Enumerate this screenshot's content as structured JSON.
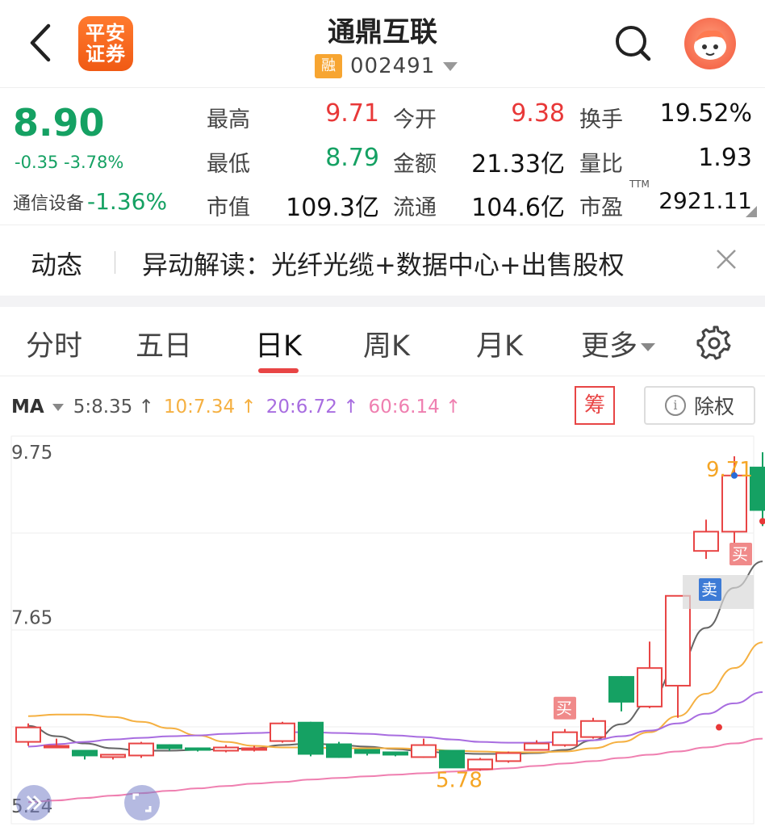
{
  "header": {
    "logo_line1": "平安",
    "logo_line2": "证券",
    "stock_name": "通鼎互联",
    "margin_badge": "融",
    "stock_code": "002491"
  },
  "quote": {
    "price": "8.90",
    "change": "-0.35 -3.78%",
    "sector_name": "通信设备",
    "sector_change": "-1.36%",
    "fields": [
      {
        "label": "最高",
        "value": "9.71",
        "tone": "red"
      },
      {
        "label": "今开",
        "value": "9.38",
        "tone": "red"
      },
      {
        "label": "换手",
        "value": "19.52%",
        "tone": "black"
      },
      {
        "label": "最低",
        "value": "8.79",
        "tone": "green"
      },
      {
        "label": "金额",
        "value": "21.33亿",
        "tone": "black"
      },
      {
        "label": "量比",
        "value": "1.93",
        "tone": "black"
      },
      {
        "label": "市值",
        "value": "109.3亿",
        "tone": "black"
      },
      {
        "label": "流通",
        "value": "104.6亿",
        "tone": "black"
      },
      {
        "label": "市盈",
        "value": "2921.11",
        "tone": "black"
      }
    ],
    "ttm_label": "TTM"
  },
  "news": {
    "label": "动态",
    "text": "异动解读：光纤光缆+数据中心+出售股权"
  },
  "tabs": [
    {
      "label": "分时"
    },
    {
      "label": "五日"
    },
    {
      "label": "日K",
      "active": true
    },
    {
      "label": "周K"
    },
    {
      "label": "月K"
    },
    {
      "label": "更多"
    }
  ],
  "ma": {
    "name": "MA",
    "items": [
      {
        "text": "5:8.35 ↑",
        "color": "#555555"
      },
      {
        "text": "10:7.34 ↑",
        "color": "#f5b041"
      },
      {
        "text": "20:6.72 ↑",
        "color": "#a86de0"
      },
      {
        "text": "60:6.14 ↑",
        "color": "#ef7fb0"
      }
    ],
    "chou_label": "筹",
    "chuquan_label": "除权"
  },
  "chart_data": {
    "type": "candlestick",
    "ylim": [
      5.24,
      9.75
    ],
    "y_tick_labels": [
      "9.75",
      "7.65",
      "5.24"
    ],
    "high_label": "9.71",
    "low_label": "5.78",
    "buy_label": "买",
    "sell_label": "卖",
    "candles": [
      {
        "o": 6.1,
        "c": 6.28,
        "h": 6.33,
        "l": 6.05
      },
      {
        "o": 6.05,
        "c": 6.05,
        "h": 6.14,
        "l": 6.02
      },
      {
        "o": 5.99,
        "c": 5.93,
        "h": 6.0,
        "l": 5.88
      },
      {
        "o": 5.91,
        "c": 5.94,
        "h": 5.95,
        "l": 5.88
      },
      {
        "o": 5.93,
        "c": 6.08,
        "h": 6.1,
        "l": 5.9
      },
      {
        "o": 6.06,
        "c": 6.02,
        "h": 6.07,
        "l": 5.99
      },
      {
        "o": 6.02,
        "c": 6.0,
        "h": 6.03,
        "l": 5.98
      },
      {
        "o": 5.99,
        "c": 6.03,
        "h": 6.06,
        "l": 5.97
      },
      {
        "o": 6.01,
        "c": 6.02,
        "h": 6.05,
        "l": 5.98
      },
      {
        "o": 6.11,
        "c": 6.33,
        "h": 6.35,
        "l": 6.09
      },
      {
        "o": 6.34,
        "c": 5.95,
        "h": 6.35,
        "l": 5.92
      },
      {
        "o": 6.07,
        "c": 5.91,
        "h": 6.1,
        "l": 5.9
      },
      {
        "o": 6.0,
        "c": 5.96,
        "h": 6.01,
        "l": 5.93
      },
      {
        "o": 5.97,
        "c": 5.94,
        "h": 5.98,
        "l": 5.92
      },
      {
        "o": 5.91,
        "c": 6.06,
        "h": 6.14,
        "l": 5.9
      },
      {
        "o": 5.99,
        "c": 5.78,
        "h": 6.0,
        "l": 5.78
      },
      {
        "o": 5.76,
        "c": 5.88,
        "h": 5.9,
        "l": 5.74
      },
      {
        "o": 5.86,
        "c": 5.96,
        "h": 5.98,
        "l": 5.84
      },
      {
        "o": 6.0,
        "c": 6.08,
        "h": 6.12,
        "l": 5.99
      },
      {
        "o": 6.06,
        "c": 6.22,
        "h": 6.26,
        "l": 6.04
      },
      {
        "o": 6.16,
        "c": 6.36,
        "h": 6.4,
        "l": 6.14
      },
      {
        "o": 6.91,
        "c": 6.6,
        "h": 6.92,
        "l": 6.48
      },
      {
        "o": 6.54,
        "c": 7.02,
        "h": 7.35,
        "l": 6.52
      },
      {
        "o": 6.8,
        "c": 7.92,
        "h": 7.92,
        "l": 6.4
      },
      {
        "o": 8.48,
        "c": 8.72,
        "h": 8.87,
        "l": 8.38
      },
      {
        "o": 8.72,
        "c": 9.42,
        "h": 9.66,
        "l": 8.56
      },
      {
        "o": 9.52,
        "c": 8.99,
        "h": 9.71,
        "l": 8.79
      }
    ],
    "series": [
      {
        "name": "MA5",
        "color": "#666666",
        "values": [
          6.3,
          6.17,
          6.08,
          6.02,
          5.99,
          5.99,
          6.0,
          6.01,
          6.02,
          6.06,
          6.08,
          6.06,
          6.04,
          6.01,
          5.98,
          5.96,
          5.95,
          5.95,
          5.96,
          6.0,
          6.12,
          6.32,
          6.6,
          7.05,
          7.52,
          8.02,
          8.35
        ]
      },
      {
        "name": "MA10",
        "color": "#f5b041",
        "values": [
          6.42,
          6.44,
          6.44,
          6.41,
          6.35,
          6.27,
          6.18,
          6.1,
          6.05,
          6.03,
          6.03,
          6.02,
          6.02,
          6.02,
          6.01,
          5.99,
          5.98,
          5.97,
          5.97,
          5.98,
          6.02,
          6.1,
          6.22,
          6.42,
          6.7,
          7.02,
          7.34
        ]
      },
      {
        "name": "MA20",
        "color": "#a86de0",
        "values": [
          6.04,
          6.07,
          6.1,
          6.13,
          6.15,
          6.17,
          6.18,
          6.2,
          6.21,
          6.22,
          6.22,
          6.21,
          6.2,
          6.18,
          6.16,
          6.13,
          6.1,
          6.09,
          6.09,
          6.1,
          6.12,
          6.17,
          6.24,
          6.33,
          6.45,
          6.58,
          6.72
        ]
      },
      {
        "name": "MA60",
        "color": "#ef7fb0",
        "values": [
          5.35,
          5.37,
          5.4,
          5.43,
          5.46,
          5.49,
          5.52,
          5.55,
          5.58,
          5.6,
          5.63,
          5.65,
          5.67,
          5.69,
          5.71,
          5.73,
          5.75,
          5.77,
          5.8,
          5.83,
          5.86,
          5.9,
          5.94,
          5.98,
          6.03,
          6.08,
          6.14
        ]
      }
    ],
    "markers": [
      {
        "index": 19,
        "kind": "buy"
      },
      {
        "index": 24,
        "kind": "buy"
      },
      {
        "index": 26,
        "kind": "sell"
      }
    ]
  }
}
